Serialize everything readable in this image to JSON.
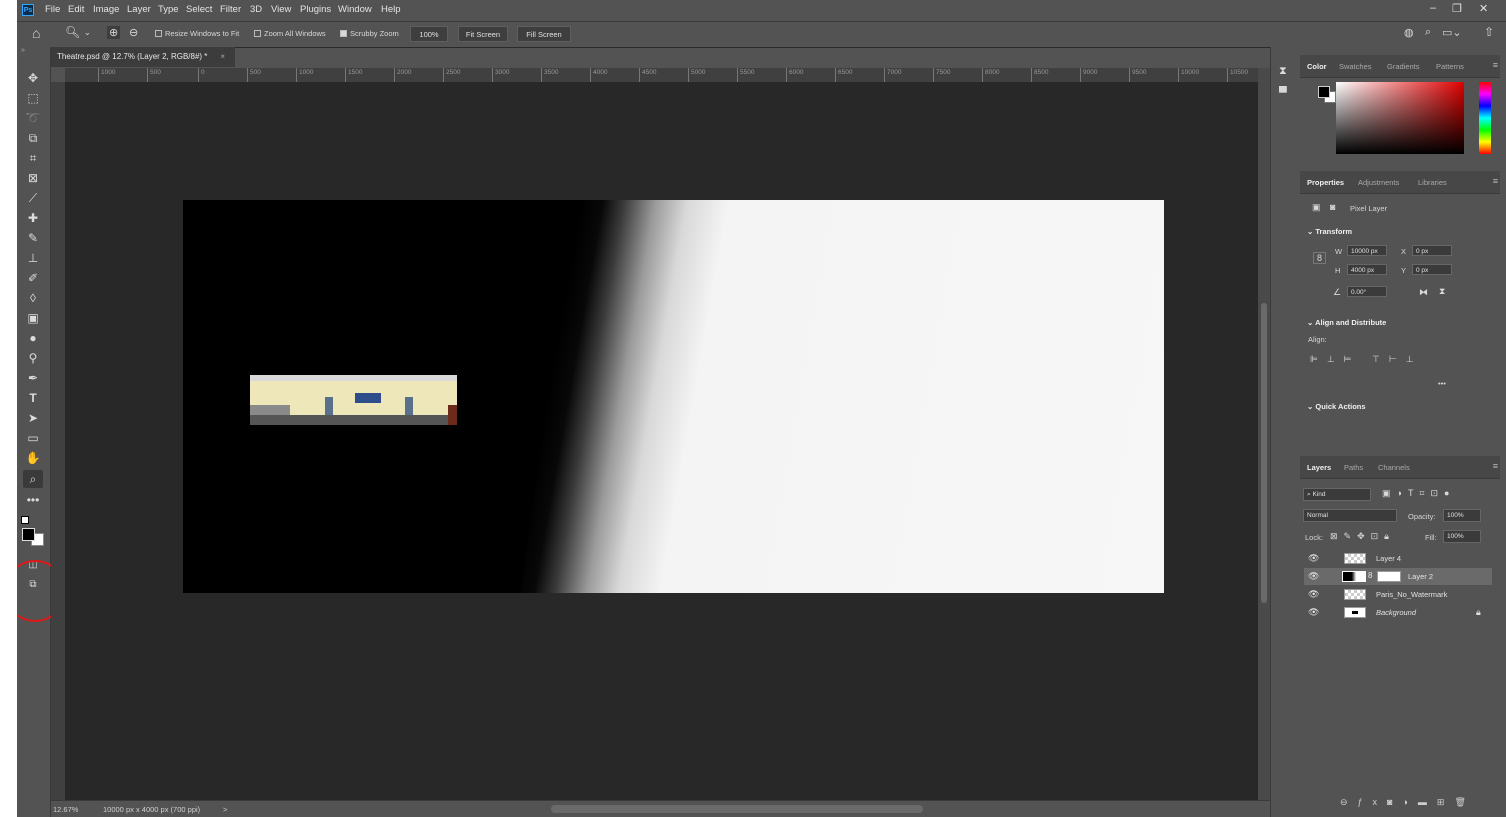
{
  "app": {
    "logo": "Ps"
  },
  "menubar": {
    "items": [
      "File",
      "Edit",
      "Image",
      "Layer",
      "Type",
      "Select",
      "Filter",
      "3D",
      "View",
      "Plugins",
      "Window",
      "Help"
    ]
  },
  "options": {
    "resize_windows": "Resize Windows to Fit",
    "zoom_all": "Zoom All Windows",
    "scrubby": "Scrubby Zoom",
    "zoom_value": "100%",
    "fit_screen": "Fit Screen",
    "fill_screen": "Fill Screen"
  },
  "document": {
    "tab_title": "Theatre.psd @ 12.7% (Layer 2, RGB/8#) *",
    "close": "×"
  },
  "ruler": {
    "labels": [
      "1000",
      "500",
      "0",
      "500",
      "1000",
      "1500",
      "2000",
      "2500",
      "3000",
      "3500",
      "4000",
      "4500",
      "5000",
      "5500",
      "6000",
      "6500",
      "7000",
      "7500",
      "8000",
      "8500",
      "9000",
      "9500",
      "10000",
      "10500"
    ]
  },
  "status": {
    "zoom": "12.67%",
    "info": "10000 px x 4000 px (700 ppi)",
    "arrow": ">"
  },
  "color_panel": {
    "tabs": [
      "Color",
      "Swatches",
      "Gradients",
      "Patterns"
    ],
    "fg_color": "#000000",
    "bg_color": "#ffffff"
  },
  "properties": {
    "tabs": [
      "Properties",
      "Adjustments",
      "Libraries"
    ],
    "kind": "Pixel Layer",
    "transform_title": "Transform",
    "w_label": "W",
    "w": "10000 px",
    "h_label": "H",
    "h": "4000 px",
    "x_label": "X",
    "x": "0 px",
    "y_label": "Y",
    "y": "0 px",
    "angle": "0.00°",
    "align_title": "Align and Distribute",
    "align_label": "Align:",
    "more": "•••",
    "quick_title": "Quick Actions"
  },
  "layers_panel": {
    "tabs": [
      "Layers",
      "Paths",
      "Channels"
    ],
    "kind": "Kind",
    "blend": "Normal",
    "opacity_label": "Opacity:",
    "opacity": "100%",
    "lock_label": "Lock:",
    "fill_label": "Fill:",
    "fill": "100%",
    "layers": [
      {
        "name": "Layer 4"
      },
      {
        "name": "Layer 2"
      },
      {
        "name": "Paris_No_Watermark"
      },
      {
        "name": "Background"
      }
    ]
  }
}
